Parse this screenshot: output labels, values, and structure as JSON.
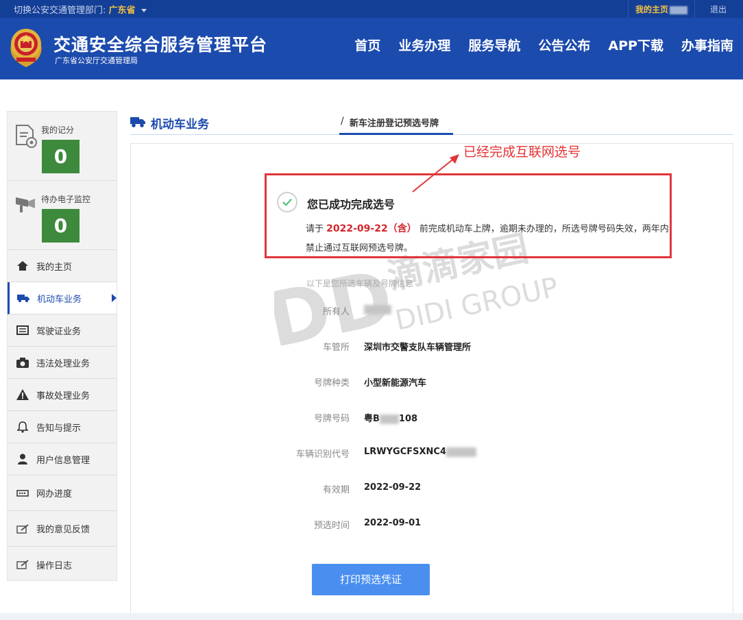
{
  "topbar": {
    "switch_prefix": "切换公安交通管理部门:",
    "switch_value": "广东省",
    "home_link": "我的主页",
    "logout": "退出"
  },
  "header": {
    "title": "交通安全综合服务管理平台",
    "subtitle": "广东省公安厅交通管理局",
    "nav": [
      "首页",
      "业务办理",
      "服务导航",
      "公告公布",
      "APP下载",
      "办事指南"
    ]
  },
  "sidebar": {
    "stats": [
      {
        "label": "我的记分",
        "value": "0",
        "icon": "document-gear-icon"
      },
      {
        "label": "待办电子监控",
        "value": "0",
        "icon": "camera-monitor-icon"
      }
    ],
    "items": [
      {
        "label": "我的主页",
        "icon": "home-icon"
      },
      {
        "label": "机动车业务",
        "icon": "truck-icon"
      },
      {
        "label": "驾驶证业务",
        "icon": "license-card-icon"
      },
      {
        "label": "违法处理业务",
        "icon": "camera-icon"
      },
      {
        "label": "事故处理业务",
        "icon": "warning-icon"
      },
      {
        "label": "告知与提示",
        "icon": "bell-icon"
      },
      {
        "label": "用户信息管理",
        "icon": "user-icon"
      },
      {
        "label": "网办进度",
        "icon": "progress-icon"
      },
      {
        "label": "我的意见反馈",
        "icon": "feedback-icon"
      },
      {
        "label": "操作日志",
        "icon": "log-icon"
      }
    ],
    "active_index": 1
  },
  "breadcrumb": {
    "section": "机动车业务",
    "separator": "/",
    "page": "新车注册登记预选号牌"
  },
  "annotation": "已经完成互联网选号",
  "result": {
    "title": "您已成功完成选号",
    "msg_prefix": "请于",
    "msg_date": "2022-09-22（含）",
    "msg_suffix": "前完成机动车上牌，逾期未办理的，所选号牌号码失效，两年内禁止通过互联网预选号牌。"
  },
  "info": {
    "caption": "以下是您所选车辆及号牌信息",
    "rows": [
      {
        "label": "所有人",
        "value": ""
      },
      {
        "label": "车管所",
        "value": "深圳市交警支队车辆管理所"
      },
      {
        "label": "号牌种类",
        "value": "小型新能源汽车"
      },
      {
        "label": "号牌号码",
        "value_prefix": "粤B",
        "value_suffix": "108"
      },
      {
        "label": "车辆识别代号",
        "value_prefix": "LRWYGCFSXNC4",
        "value_suffix": ""
      },
      {
        "label": "有效期",
        "value": "2022-09-22"
      },
      {
        "label": "预选时间",
        "value": "2022-09-01"
      }
    ]
  },
  "print_button": "打印预选凭证",
  "watermark": {
    "brand": "DD",
    "cn": "滴滴家园",
    "en": "DIDI GROUP"
  },
  "colors": {
    "header_blue": "#1c4bae",
    "top_strip": "#143f96",
    "accent_gold": "#f5c242",
    "score_green": "#3d8a3d",
    "alert_red": "#e0353b",
    "button_blue": "#4a8ff0"
  }
}
